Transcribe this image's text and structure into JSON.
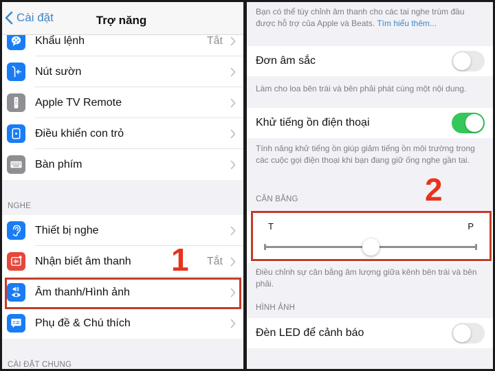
{
  "left_panel": {
    "navbar": {
      "back_label": "Cài đặt",
      "title": "Trợ năng"
    },
    "top_items": [
      {
        "label": "Khẩu lệnh",
        "value": "Tắt",
        "icon": "voice-control-icon",
        "icon_color": "#1a7cf5"
      },
      {
        "label": "Nút sườn",
        "value": "",
        "icon": "side-button-icon",
        "icon_color": "#1a7cf5"
      },
      {
        "label": "Apple TV Remote",
        "value": "",
        "icon": "tv-remote-icon",
        "icon_color": "#8e8e93"
      },
      {
        "label": "Điều khiển con trỏ",
        "value": "",
        "icon": "pointer-control-icon",
        "icon_color": "#1a7cf5"
      },
      {
        "label": "Bàn phím",
        "value": "",
        "icon": "keyboard-icon",
        "icon_color": "#8e8e93"
      }
    ],
    "hearing_section_label": "NGHE",
    "hearing_items": [
      {
        "label": "Thiết bị nghe",
        "value": "",
        "icon": "ear-icon",
        "icon_color": "#1a7cf5"
      },
      {
        "label": "Nhận biết âm thanh",
        "value": "Tắt",
        "icon": "sound-recognition-icon",
        "icon_color": "#e5473c"
      },
      {
        "label": "Âm thanh/Hình ảnh",
        "value": "",
        "icon": "audio-visual-icon",
        "icon_color": "#1a7cf5",
        "highlighted": true
      },
      {
        "label": "Phụ đề & Chú thích",
        "value": "",
        "icon": "subtitles-icon",
        "icon_color": "#1a7cf5"
      }
    ],
    "general_section_label": "CÀI ĐẶT CHUNG",
    "annotation_number": "1"
  },
  "right_panel": {
    "headphone_footer": "Bạn có thể tùy chỉnh âm thanh cho các tai nghe trùm đầu được hỗ trợ của Apple và Beats.",
    "headphone_footer_link": "Tìm hiểu thêm...",
    "mono_audio": {
      "label": "Đơn âm sắc",
      "on": false
    },
    "mono_audio_footer": "Làm cho loa bên trái và bên phải phát cùng một nội dung.",
    "noise_cancellation": {
      "label": "Khử tiếng ồn điện thoại",
      "on": true
    },
    "noise_cancellation_footer": "Tính năng khử tiếng ồn giúp giảm tiếng ồn môi trường trong các cuộc gọi điện thoại khi bạn đang giữ ống nghe gần tai.",
    "balance_section_label": "CÂN BẰNG",
    "balance": {
      "left_label": "T",
      "right_label": "P",
      "value": 0.5
    },
    "balance_footer": "Điều chỉnh sự cân bằng âm lượng giữa kênh bên trái và bên phải.",
    "visual_section_label": "HÌNH ẢNH",
    "led_flash": {
      "label": "Đèn LED để cảnh báo",
      "on": false
    },
    "annotation_number": "2"
  },
  "colors": {
    "accent_blue": "#3d86c9",
    "annotation_red": "#e8331c",
    "annotation_box": "#c43b2a",
    "toggle_on": "#34c759",
    "toggle_off": "#e9e9ea"
  }
}
